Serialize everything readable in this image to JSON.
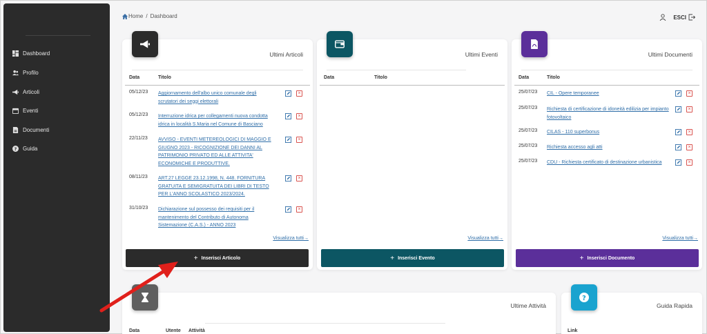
{
  "breadcrumb": {
    "home": "Home",
    "separator": "/",
    "current": "Dashboard"
  },
  "header": {
    "logout_label": "ESCI"
  },
  "sidebar": {
    "items": [
      {
        "label": "Dashboard",
        "icon": "dashboard-icon"
      },
      {
        "label": "Profilo",
        "icon": "users-icon"
      },
      {
        "label": "Articoli",
        "icon": "megaphone-icon"
      },
      {
        "label": "Eventi",
        "icon": "calendar-icon"
      },
      {
        "label": "Documenti",
        "icon": "document-icon"
      },
      {
        "label": "Guida",
        "icon": "help-icon"
      }
    ]
  },
  "colors": {
    "articoli": "#2b2b2b",
    "eventi": "#0c5663",
    "documenti": "#5b2f9a",
    "attivita": "#5f5f5f",
    "guida": "#1aa3cf",
    "link": "#2f6ea8",
    "delete": "#d9534f"
  },
  "articoli": {
    "title": "Ultimi Articoli",
    "col_date": "Data",
    "col_title": "Titolo",
    "rows": [
      {
        "date": "05/12/23",
        "title": "Aggiornamento dell'albo unico comunale degli scrutatori dei seggi elettorali"
      },
      {
        "date": "05/12/23",
        "title": "Interruzione idrica per collegamenti nuova condotta idrica in località S.Maria nel Comune di Basciano"
      },
      {
        "date": "22/11/23",
        "title": "AVVISO - EVENTI METEREOLOGICI DI MAGGIO E GIUGNO 2023 - RICOGNIZIONE DEI DANNI AL PATRIMONIO PRIVATO ED ALLE ATTIVITA' ECONOMICHE E PRODUTTIVE."
      },
      {
        "date": "08/11/23",
        "title": "ART.27 LEGGE 23.12.1998, N. 448. FORNITURA GRATUITA E SEMIGRATUITA DEI LIBRI DI TESTO PER L'ANNO SCOLASTICO 2023/2024."
      },
      {
        "date": "31/10/23",
        "title": "Dichiarazione sul possesso dei requisiti per il mantenimento del Contributo di Autonoma Sistemazione (C.A.S.) - ANNO 2023"
      }
    ],
    "view_all": "Visualizza tutti",
    "insert_label": "Inserisci Articolo"
  },
  "eventi": {
    "title": "Ultimi Eventi",
    "col_date": "Data",
    "col_title": "Titolo",
    "view_all": "Visualizza tutti",
    "insert_label": "Inserisci Evento"
  },
  "documenti": {
    "title": "Ultimi Documenti",
    "col_date": "Data",
    "col_title": "Titolo",
    "rows": [
      {
        "date": "25/07/23",
        "title": "CIL - Opere temporanee"
      },
      {
        "date": "25/07/23",
        "title": "Richiesta di certificazione di idoneità edilizia per impianto fotovoltaico"
      },
      {
        "date": "25/07/23",
        "title": "CILAS - 110 superbonus"
      },
      {
        "date": "25/07/23",
        "title": "Richiesta accesso agli atti"
      },
      {
        "date": "25/07/23",
        "title": "CDU - Richiesta certificato di destinazione urbanistica"
      }
    ],
    "view_all": "Visualizza tutti",
    "insert_label": "Inserisci Documento"
  },
  "attivita": {
    "title": "Ultime Attività",
    "col_date": "Data",
    "col_user": "Utente",
    "col_activity": "Attività"
  },
  "guida": {
    "title": "Guida Rapida",
    "col_link": "Link"
  }
}
